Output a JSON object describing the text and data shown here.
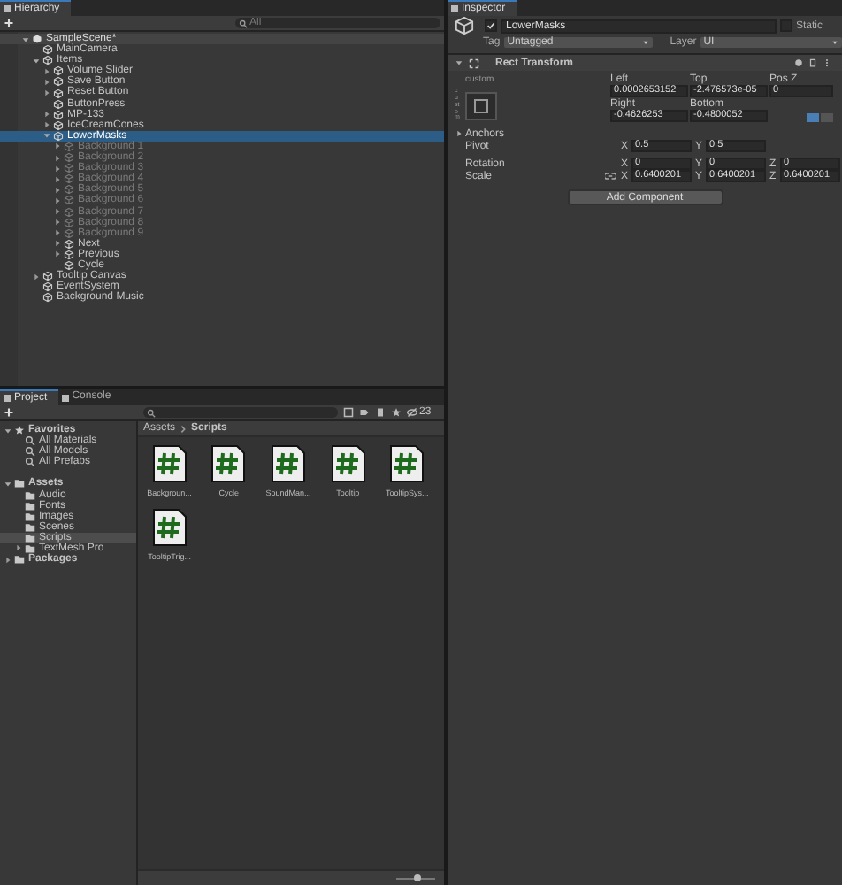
{
  "hierarchy": {
    "tab": "Hierarchy",
    "search_placeholder": "All",
    "tree": [
      {
        "label": "SampleScene*",
        "kind": "scene",
        "expanded": true,
        "selected": false,
        "active": true,
        "children": [
          {
            "label": "MainCamera",
            "kind": "object",
            "selected": false,
            "active": true
          },
          {
            "label": "Items",
            "kind": "object",
            "expanded": true,
            "selected": false,
            "active": true,
            "children": [
              {
                "label": "Volume Slider",
                "kind": "object",
                "expanded": false,
                "selected": false,
                "active": true
              },
              {
                "label": "Save Button",
                "kind": "object",
                "expanded": false,
                "selected": false,
                "active": true
              },
              {
                "label": "Reset Button",
                "kind": "object",
                "expanded": false,
                "selected": false,
                "active": true
              },
              {
                "label": "ButtonPress",
                "kind": "object",
                "selected": false,
                "active": true
              },
              {
                "label": "MP-133",
                "kind": "object",
                "expanded": false,
                "selected": false,
                "active": true
              },
              {
                "label": "IceCreamCones",
                "kind": "object",
                "expanded": false,
                "selected": false,
                "active": true
              },
              {
                "label": "LowerMasks",
                "kind": "object",
                "expanded": true,
                "selected": true,
                "active": true,
                "children": [
                  {
                    "label": "Background 1",
                    "kind": "object",
                    "expanded": false,
                    "selected": false,
                    "active": false
                  },
                  {
                    "label": "Background 2",
                    "kind": "object",
                    "expanded": false,
                    "selected": false,
                    "active": false
                  },
                  {
                    "label": "Background 3",
                    "kind": "object",
                    "expanded": false,
                    "selected": false,
                    "active": false
                  },
                  {
                    "label": "Background 4",
                    "kind": "object",
                    "expanded": false,
                    "selected": false,
                    "active": false
                  },
                  {
                    "label": "Background 5",
                    "kind": "object",
                    "expanded": false,
                    "selected": false,
                    "active": false
                  },
                  {
                    "label": "Background 6",
                    "kind": "object",
                    "expanded": false,
                    "selected": false,
                    "active": false
                  },
                  {
                    "label": "Background 7",
                    "kind": "object",
                    "expanded": false,
                    "selected": false,
                    "active": false
                  },
                  {
                    "label": "Background 8",
                    "kind": "object",
                    "expanded": false,
                    "selected": false,
                    "active": false
                  },
                  {
                    "label": "Background 9",
                    "kind": "object",
                    "expanded": false,
                    "selected": false,
                    "active": false
                  },
                  {
                    "label": "Next",
                    "kind": "object",
                    "expanded": false,
                    "selected": false,
                    "active": true
                  },
                  {
                    "label": "Previous",
                    "kind": "object",
                    "expanded": false,
                    "selected": false,
                    "active": true
                  },
                  {
                    "label": "Cycle",
                    "kind": "object",
                    "selected": false,
                    "active": true
                  }
                ]
              }
            ]
          },
          {
            "label": "Tooltip Canvas",
            "kind": "object",
            "expanded": false,
            "selected": false,
            "active": true
          },
          {
            "label": "EventSystem",
            "kind": "object",
            "selected": false,
            "active": true
          },
          {
            "label": "Background Music",
            "kind": "object",
            "selected": false,
            "active": true
          }
        ]
      }
    ]
  },
  "inspector": {
    "tab": "Inspector",
    "object": {
      "active": true,
      "name": "LowerMasks",
      "static_label": "Static",
      "static": false
    },
    "tag_label": "Tag",
    "tag": "Untagged",
    "layer_label": "Layer",
    "layer": "UI",
    "component": {
      "title": "Rect Transform",
      "expanded": true,
      "preset_top": "custom",
      "preset_side": "custom",
      "position_fields": [
        {
          "label": "Left",
          "value": "0.0002653152"
        },
        {
          "label": "Top",
          "value": "-2.476573e-05"
        },
        {
          "label": "Pos Z",
          "value": "0"
        },
        {
          "label": "Right",
          "value": "-0.4626253"
        },
        {
          "label": "Bottom",
          "value": "-0.4800052"
        }
      ],
      "anchors": {
        "label": "Anchors",
        "expanded": false
      },
      "rows": [
        {
          "label": "Pivot",
          "linked": false,
          "fields": [
            {
              "axis": "X",
              "value": "0.5"
            },
            {
              "axis": "Y",
              "value": "0.5"
            }
          ]
        },
        {
          "label": "Rotation",
          "linked": false,
          "fields": [
            {
              "axis": "X",
              "value": "0"
            },
            {
              "axis": "Y",
              "value": "0"
            },
            {
              "axis": "Z",
              "value": "0"
            }
          ]
        },
        {
          "label": "Scale",
          "linked": true,
          "fields": [
            {
              "axis": "X",
              "value": "0.6400201"
            },
            {
              "axis": "Y",
              "value": "0.6400201"
            },
            {
              "axis": "Z",
              "value": "0.6400201"
            }
          ]
        }
      ]
    },
    "add_component": "Add Component"
  },
  "project": {
    "tabs": [
      {
        "label": "Project",
        "selected": true
      },
      {
        "label": "Console",
        "selected": false
      }
    ],
    "hidden_count": "23",
    "sidebar": [
      {
        "label": "Favorites",
        "kind": "favorites",
        "expanded": true,
        "selected": false,
        "children": [
          {
            "label": "All Materials",
            "kind": "search",
            "selected": false
          },
          {
            "label": "All Models",
            "kind": "search",
            "selected": false
          },
          {
            "label": "All Prefabs",
            "kind": "search",
            "selected": false
          }
        ]
      },
      {
        "label": "Assets",
        "kind": "folder",
        "expanded": true,
        "selected": false,
        "children": [
          {
            "label": "Audio",
            "kind": "folder",
            "selected": false
          },
          {
            "label": "Fonts",
            "kind": "folder",
            "selected": false
          },
          {
            "label": "Images",
            "kind": "folder",
            "selected": false
          },
          {
            "label": "Scenes",
            "kind": "folder",
            "selected": false
          },
          {
            "label": "Scripts",
            "kind": "folder",
            "selected": true
          },
          {
            "label": "TextMesh Pro",
            "kind": "folder",
            "expanded": false,
            "selected": false
          }
        ]
      },
      {
        "label": "Packages",
        "kind": "folder",
        "expanded": false,
        "selected": false
      }
    ],
    "breadcrumb": [
      "Assets",
      "Scripts"
    ],
    "files": [
      {
        "name": "Backgroun..."
      },
      {
        "name": "Cycle"
      },
      {
        "name": "SoundMan..."
      },
      {
        "name": "Tooltip"
      },
      {
        "name": "TooltipSys..."
      },
      {
        "name": "TooltipTrig..."
      }
    ],
    "zoom": {
      "level": 0.55
    }
  }
}
